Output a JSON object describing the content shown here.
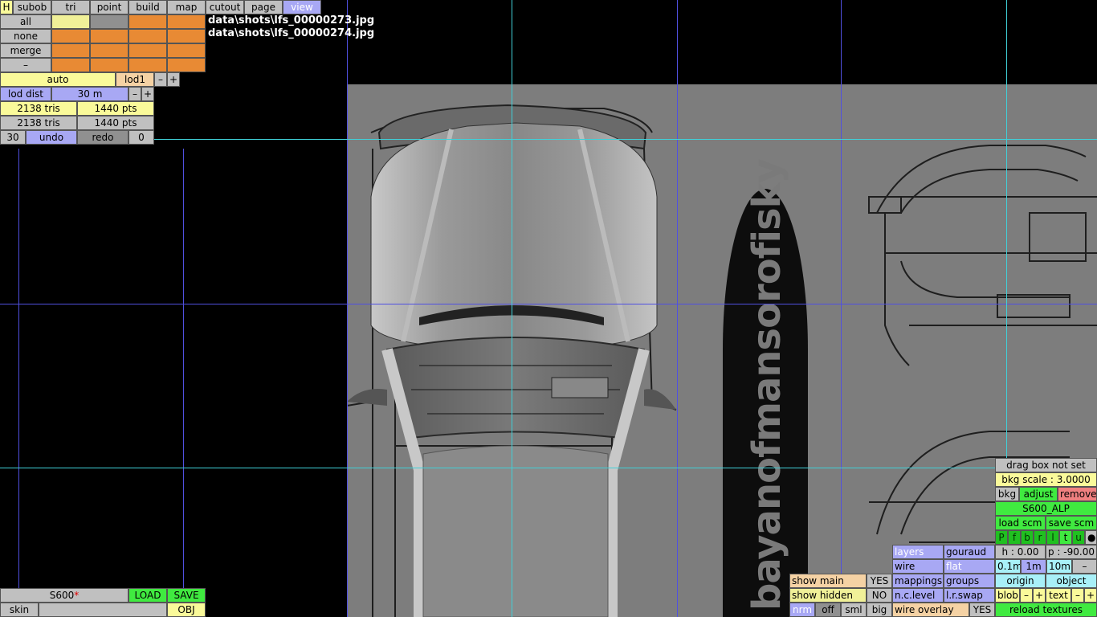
{
  "tabs": {
    "h": "H",
    "subob": "subob",
    "tri": "tri",
    "point": "point",
    "build": "build",
    "map": "map",
    "cutout": "cutout",
    "page": "page",
    "view": "view"
  },
  "sel_rows": [
    "all",
    "none",
    "merge",
    "–"
  ],
  "lod": {
    "auto": "auto",
    "level": "lod1",
    "minus": "–",
    "plus": "+"
  },
  "lod_dist": {
    "label": "lod dist",
    "value": "30 m",
    "minus": "–",
    "plus": "+"
  },
  "counts": {
    "row1_tris": "2138 tris",
    "row1_pts": "1440 pts",
    "row2_tris": "2138 tris",
    "row2_pts": "1440 pts"
  },
  "undo": {
    "count": "30",
    "undo": "undo",
    "redo": "redo",
    "redo_count": "0"
  },
  "shots": [
    "data\\shots\\lfs_00000273.jpg",
    "data\\shots\\lfs_00000274.jpg"
  ],
  "file": {
    "name": "S600",
    "modified_mark": "*",
    "load": "LOAD",
    "save": "SAVE",
    "skin": "skin",
    "obj": "OBJ"
  },
  "show": {
    "main_label": "show main",
    "main_value": "YES",
    "hidden_label": "show hidden",
    "hidden_value": "NO",
    "nrm": "nrm",
    "off": "off",
    "sml": "sml",
    "big": "big"
  },
  "render": {
    "layers": "layers",
    "gouraud": "gouraud",
    "wire": "wire",
    "flat": "flat",
    "mappings": "mappings",
    "groups": "groups",
    "nclevel": "n.c.level",
    "lrswap": "l.r.swap",
    "wire_overlay": "wire overlay",
    "wire_overlay_value": "YES"
  },
  "bkg": {
    "drag_box": "drag box not set",
    "scale": "bkg scale : 3.0000",
    "bkg": "bkg",
    "adjust": "adjust",
    "remove": "remove",
    "name": "S600_ALP",
    "load_scm": "load scm",
    "save_scm": "save scm",
    "views": [
      "P",
      "f",
      "b",
      "r",
      "l",
      "t",
      "u",
      "●"
    ],
    "h": "h : 0.00",
    "p": "p : -90.00",
    "steps": [
      "0.1m",
      "1m",
      "10m",
      "–"
    ],
    "origin": "origin",
    "object": "object",
    "blob": "blob",
    "text": "text",
    "minus": "–",
    "plus": "+",
    "reload": "reload textures"
  },
  "watermark": "bayanofmansorofisky"
}
